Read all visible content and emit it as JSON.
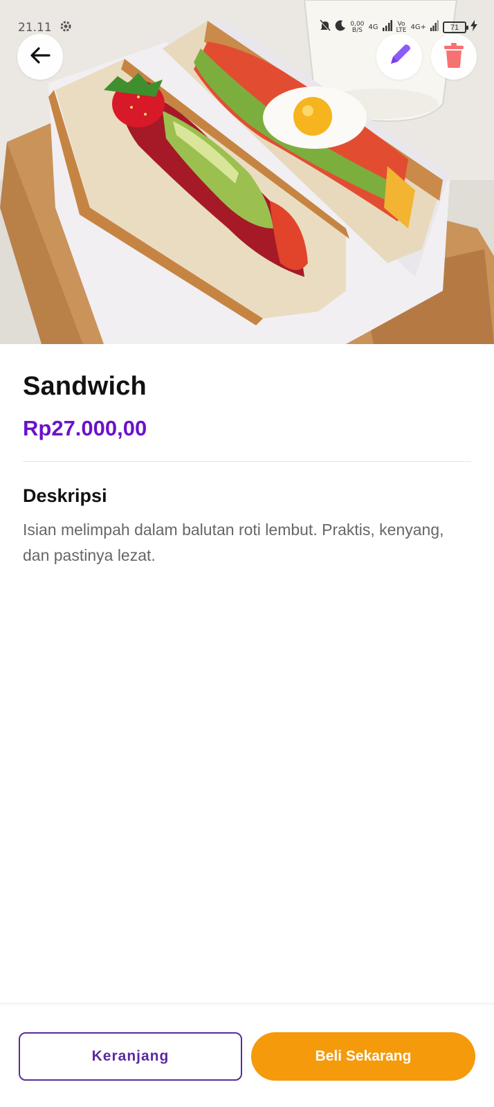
{
  "status_bar": {
    "time": "21.11",
    "net_speed_value": "0,00",
    "net_speed_unit": "B/S",
    "signal_1": "4G",
    "volte_top": "Vo",
    "volte_bottom": "LTE",
    "signal_2": "4G+",
    "battery": "71"
  },
  "hero": {
    "icon_back": "arrow-left",
    "icon_edit": "pencil",
    "icon_delete": "trash",
    "edit_color": "#8b5cf6",
    "delete_color": "#f87171"
  },
  "product": {
    "name": "Sandwich",
    "price": "Rp27.000,00",
    "description_heading": "Deskripsi",
    "description": "Isian melimpah dalam balutan roti lembut. Praktis, kenyang, dan pastinya lezat."
  },
  "actions": {
    "cart_label": "Keranjang",
    "buy_label": "Beli Sekarang",
    "accent_color": "#f59a0b",
    "brand_color": "#6a11cb"
  }
}
